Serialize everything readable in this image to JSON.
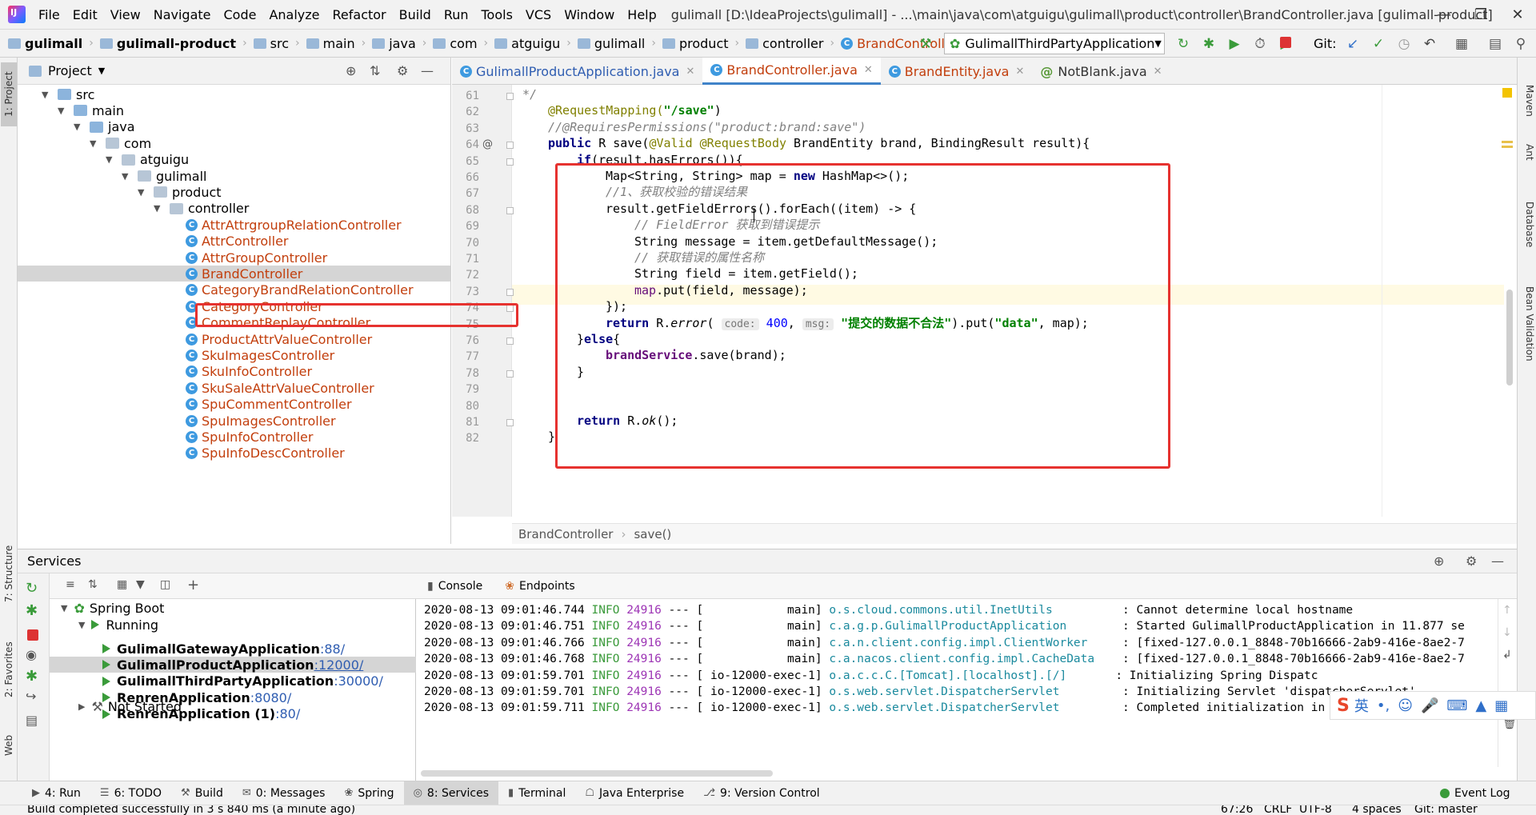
{
  "menubar": {
    "items": [
      "File",
      "Edit",
      "View",
      "Navigate",
      "Code",
      "Analyze",
      "Refactor",
      "Build",
      "Run",
      "Tools",
      "VCS",
      "Window",
      "Help"
    ],
    "title": "gulimall [D:\\IdeaProjects\\gulimall] - ...\\main\\java\\com\\atguigu\\gulimall\\product\\controller\\BrandController.java [gulimall-product]"
  },
  "navbar": {
    "crumbs": [
      "gulimall",
      "gulimall-product",
      "src",
      "main",
      "java",
      "com",
      "atguigu",
      "gulimall",
      "product",
      "controller"
    ],
    "file": "BrandController",
    "run_config": "GulimallThirdPartyApplication",
    "git_label": "Git:"
  },
  "left_stripe": {
    "project": "1: Project",
    "structure": "7: Structure",
    "favorites": "2: Favorites",
    "web": "Web"
  },
  "right_stripe": {
    "maven": "Maven",
    "ant": "Ant",
    "database": "Database",
    "bean": "Bean Validation"
  },
  "project": {
    "header": "Project",
    "tree": [
      {
        "label": "src",
        "depth": 1,
        "kind": "folder",
        "open": true
      },
      {
        "label": "main",
        "depth": 2,
        "kind": "folder",
        "open": true
      },
      {
        "label": "java",
        "depth": 3,
        "kind": "folder",
        "open": true
      },
      {
        "label": "com",
        "depth": 4,
        "kind": "pkg",
        "open": true
      },
      {
        "label": "atguigu",
        "depth": 5,
        "kind": "pkg",
        "open": true
      },
      {
        "label": "gulimall",
        "depth": 6,
        "kind": "pkg",
        "open": true
      },
      {
        "label": "product",
        "depth": 7,
        "kind": "pkg",
        "open": true
      },
      {
        "label": "controller",
        "depth": 8,
        "kind": "pkg",
        "open": true
      },
      {
        "label": "AttrAttrgroupRelationController",
        "depth": 9,
        "kind": "class"
      },
      {
        "label": "AttrController",
        "depth": 9,
        "kind": "class"
      },
      {
        "label": "AttrGroupController",
        "depth": 9,
        "kind": "class"
      },
      {
        "label": "BrandController",
        "depth": 9,
        "kind": "class",
        "selected": true
      },
      {
        "label": "CategoryBrandRelationController",
        "depth": 9,
        "kind": "class"
      },
      {
        "label": "CategoryController",
        "depth": 9,
        "kind": "class"
      },
      {
        "label": "CommentReplayController",
        "depth": 9,
        "kind": "class"
      },
      {
        "label": "ProductAttrValueController",
        "depth": 9,
        "kind": "class"
      },
      {
        "label": "SkuImagesController",
        "depth": 9,
        "kind": "class"
      },
      {
        "label": "SkuInfoController",
        "depth": 9,
        "kind": "class"
      },
      {
        "label": "SkuSaleAttrValueController",
        "depth": 9,
        "kind": "class"
      },
      {
        "label": "SpuCommentController",
        "depth": 9,
        "kind": "class"
      },
      {
        "label": "SpuImagesController",
        "depth": 9,
        "kind": "class"
      },
      {
        "label": "SpuInfoController",
        "depth": 9,
        "kind": "class"
      },
      {
        "label": "SpuInfoDescController",
        "depth": 9,
        "kind": "class"
      }
    ]
  },
  "editor": {
    "tabs": [
      {
        "label": "GulimallProductApplication.java",
        "active": false
      },
      {
        "label": "BrandController.java",
        "active": true
      },
      {
        "label": "BrandEntity.java",
        "active": false
      },
      {
        "label": "NotBlank.java",
        "active": false
      }
    ],
    "line_numbers": [
      "61",
      "62",
      "63",
      "64",
      "65",
      "66",
      "67",
      "68",
      "69",
      "70",
      "71",
      "72",
      "73",
      "74",
      "75",
      "76",
      "77",
      "78",
      "79",
      "80",
      "81",
      "82"
    ],
    "breadcrumb": [
      "BrandController",
      "save()"
    ],
    "code": {
      "l61": "*/",
      "l62_ann": "@RequestMapping(",
      "l62_str": "\"/save\"",
      "l62_end": ")",
      "l63": "//@RequiresPermissions(\"product:brand:save\")",
      "l64_kw1": "public",
      "l64_a": " R save(",
      "l64_ann1": "@Valid",
      "l64_ann2": "@RequestBody",
      "l64_b": " BrandEntity brand, BindingResult result){",
      "l65_kw": "if",
      "l65_rest": "(result.hasErrors()){",
      "l66_a": "Map<String, String> map = ",
      "l66_kw": "new",
      "l66_b": " HashMap<>();",
      "l67": "//1、获取校验的错误结果",
      "l68": "result.getFieldErrors().forEach((item) -> {",
      "l69": "// FieldError 获取到错误提示",
      "l70": "String message = item.getDefaultMessage();",
      "l71": "// 获取错误的属性名称",
      "l72": "String field = item.getField();",
      "l73_fld": "map",
      "l73_rest": ".put(field, message);",
      "l74": "});",
      "l75_kw": "return",
      "l75_a": " R.",
      "l75_method": "error",
      "l75_open": "(",
      "l75_hint1": "code:",
      "l75_num": "400",
      "l75_comma": ", ",
      "l75_hint2": "msg:",
      "l75_str1": "\"提交的数据不合法\"",
      "l75_mid": ").put(",
      "l75_str2": "\"data\"",
      "l75_end": ", map);",
      "l76_a": "}",
      "l76_kw": "else",
      "l76_b": "{",
      "l77_fld": "brandService",
      "l77_rest": ".save(brand);",
      "l78": "}",
      "l81_kw": "return",
      "l81_a": " R.",
      "l81_method": "ok",
      "l81_b": "();",
      "l82": "}"
    }
  },
  "services": {
    "header": "Services",
    "console_tab": "Console",
    "endpoints_tab": "Endpoints",
    "tree": {
      "root": "Spring Boot",
      "running": "Running",
      "apps": [
        {
          "name": "GulimallGatewayApplication",
          "port": ":88/"
        },
        {
          "name": "GulimallProductApplication",
          "port": ":12000/",
          "selected": true
        },
        {
          "name": "GulimallThirdPartyApplication",
          "port": ":30000/"
        },
        {
          "name": "RenrenApplication",
          "port": ":8080/"
        },
        {
          "name": "RenrenApplication (1)",
          "port": ":80/"
        }
      ],
      "not_started": "Not Started"
    },
    "log": [
      {
        "ts": "2020-08-13 09:01:46.744",
        "level": "INFO",
        "pid": "24916",
        "sep": "--- [",
        "thread": "           main]",
        "logger": "o.s.cloud.commons.util.InetUtils         ",
        "msg": ": Cannot determine local hostname"
      },
      {
        "ts": "2020-08-13 09:01:46.751",
        "level": "INFO",
        "pid": "24916",
        "sep": "--- [",
        "thread": "           main]",
        "logger": "c.a.g.p.GulimallProductApplication       ",
        "msg": ": Started GulimallProductApplication in 11.877 se"
      },
      {
        "ts": "2020-08-13 09:01:46.766",
        "level": "INFO",
        "pid": "24916",
        "sep": "--- [",
        "thread": "           main]",
        "logger": "c.a.n.client.config.impl.ClientWorker    ",
        "msg": ": [fixed-127.0.0.1_8848-70b16666-2ab9-416e-8ae2-7"
      },
      {
        "ts": "2020-08-13 09:01:46.768",
        "level": "INFO",
        "pid": "24916",
        "sep": "--- [",
        "thread": "           main]",
        "logger": "c.a.nacos.client.config.impl.CacheData   ",
        "msg": ": [fixed-127.0.0.1_8848-70b16666-2ab9-416e-8ae2-7"
      },
      {
        "ts": "2020-08-13 09:01:59.701",
        "level": "INFO",
        "pid": "24916",
        "sep": "--- [",
        "thread": "io-12000-exec-1]",
        "logger": "o.a.c.c.C.[Tomcat].[localhost].[/]      ",
        "msg": ": Initializing Spring Dispatc"
      },
      {
        "ts": "2020-08-13 09:01:59.701",
        "level": "INFO",
        "pid": "24916",
        "sep": "--- [",
        "thread": "io-12000-exec-1]",
        "logger": "o.s.web.servlet.DispatcherServlet        ",
        "msg": ": Initializing Servlet 'dispatcherServlet'"
      },
      {
        "ts": "2020-08-13 09:01:59.711",
        "level": "INFO",
        "pid": "24916",
        "sep": "--- [",
        "thread": "io-12000-exec-1]",
        "logger": "o.s.web.servlet.DispatcherServlet        ",
        "msg": ": Completed initialization in 10 ms"
      }
    ]
  },
  "bottom_tabs": [
    "4: Run",
    "6: TODO",
    "Build",
    "0: Messages",
    "Spring",
    "8: Services",
    "Terminal",
    "Java Enterprise",
    "9: Version Control"
  ],
  "event_log": "Event Log",
  "status": {
    "message": "Build completed successfully in 3 s 840 ms (a minute ago)",
    "position": "67:26",
    "line_sep": "CRLF",
    "encoding": "UTF-8",
    "indent": "4 spaces",
    "branch": "Git: master"
  },
  "ime": {
    "lang": "英"
  },
  "colors": {
    "highlight_box": "#e6322f",
    "accent": "#4083c9"
  }
}
